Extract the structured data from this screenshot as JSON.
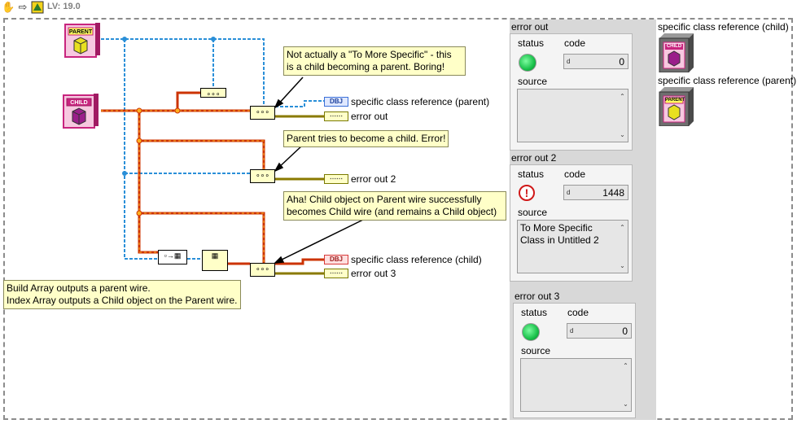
{
  "toolbar": {
    "version_label": "LV: 19.0",
    "icons": [
      "hand-icon",
      "arrow-icon",
      "labview-icon"
    ]
  },
  "classes": {
    "parent_label": "PARENT",
    "child_label": "CHILD",
    "parent_color": "#c8247e",
    "child_color": "#c8247e",
    "parent_cube_color": "#e8e020",
    "child_cube_color": "#9a1e8a"
  },
  "notes": {
    "note1": "Not actually a \"To More Specific\" - this\nis a child becoming a parent. Boring!",
    "note2": "Parent tries to become a child. Error!",
    "note3": "Aha! Child object on Parent wire successfully\nbecomes Child wire (and remains a Child object)",
    "note4": "Build Array outputs a parent wire.\nIndex Array outputs a Child object on the Parent wire."
  },
  "indicators": {
    "ref_parent": "specific class reference (parent)",
    "error_out": "error out",
    "error_out_2": "error out 2",
    "ref_child": "specific class reference (child)",
    "error_out_3": "error out 3",
    "obj_term_label": "DBJ"
  },
  "front_panel": {
    "clusters": [
      {
        "label": "error out",
        "status_label": "status",
        "code_label": "code",
        "source_label": "source",
        "status": "ok",
        "radix": "d",
        "code": "0",
        "source": ""
      },
      {
        "label": "error out 2",
        "status_label": "status",
        "code_label": "code",
        "source_label": "source",
        "status": "error",
        "radix": "d",
        "code": "1448",
        "source": "To More Specific Class in Untitled 2"
      },
      {
        "label": "error out 3",
        "status_label": "status",
        "code_label": "code",
        "source_label": "source",
        "status": "ok",
        "radix": "d",
        "code": "0",
        "source": ""
      }
    ],
    "ref_child_label": "specific class reference (child)",
    "ref_parent_label": "specific class reference (parent)",
    "ref_child_tag": "CHILD",
    "ref_parent_tag": "PARENT"
  },
  "colors": {
    "class_wire": "#cc3300",
    "class_wire_stripe": "#ffb020",
    "parent_wire": "#2a8fd8",
    "error_wire": "#8a7a00",
    "ok_led": "#19c14a",
    "error_icon": "#d01818"
  }
}
